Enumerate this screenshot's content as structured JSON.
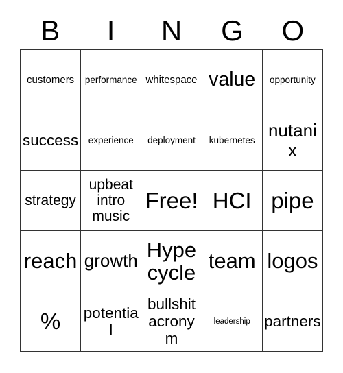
{
  "card": {
    "header_letters": [
      "B",
      "I",
      "N",
      "G",
      "O"
    ],
    "free_space_label": "Free!",
    "colors": {
      "background": "#ffffff",
      "grid_line": "#333333",
      "text": "#000000"
    },
    "rows": [
      [
        {
          "label": "customers",
          "size": "md"
        },
        {
          "label": "performance",
          "size": "sm"
        },
        {
          "label": "whitespace",
          "size": "md"
        },
        {
          "label": "value",
          "size": "4xl"
        },
        {
          "label": "opportunity",
          "size": "sm"
        }
      ],
      [
        {
          "label": "success",
          "size": "2xl"
        },
        {
          "label": "experience",
          "size": "sm"
        },
        {
          "label": "deployment",
          "size": "sm"
        },
        {
          "label": "kubernetes",
          "size": "sm"
        },
        {
          "label": "nutanix",
          "size": "3xl"
        }
      ],
      [
        {
          "label": "strategy",
          "size": "xl"
        },
        {
          "label": "upbeat\nintro\nmusic",
          "size": "xl"
        },
        {
          "label": "Free!",
          "size": "6xl"
        },
        {
          "label": "HCI",
          "size": "6xl"
        },
        {
          "label": "pipe",
          "size": "6xl"
        }
      ],
      [
        {
          "label": "reach",
          "size": "5xl"
        },
        {
          "label": "growth",
          "size": "3xl"
        },
        {
          "label": "Hype\ncycle",
          "size": "5xl"
        },
        {
          "label": "team",
          "size": "5xl"
        },
        {
          "label": "logos",
          "size": "5xl"
        }
      ],
      [
        {
          "label": "%",
          "size": "6xl"
        },
        {
          "label": "potential",
          "size": "2xl"
        },
        {
          "label": "bullshit\nacronym",
          "size": "2xl"
        },
        {
          "label": "leadership",
          "size": "xs"
        },
        {
          "label": "partners",
          "size": "2xl"
        }
      ]
    ]
  }
}
